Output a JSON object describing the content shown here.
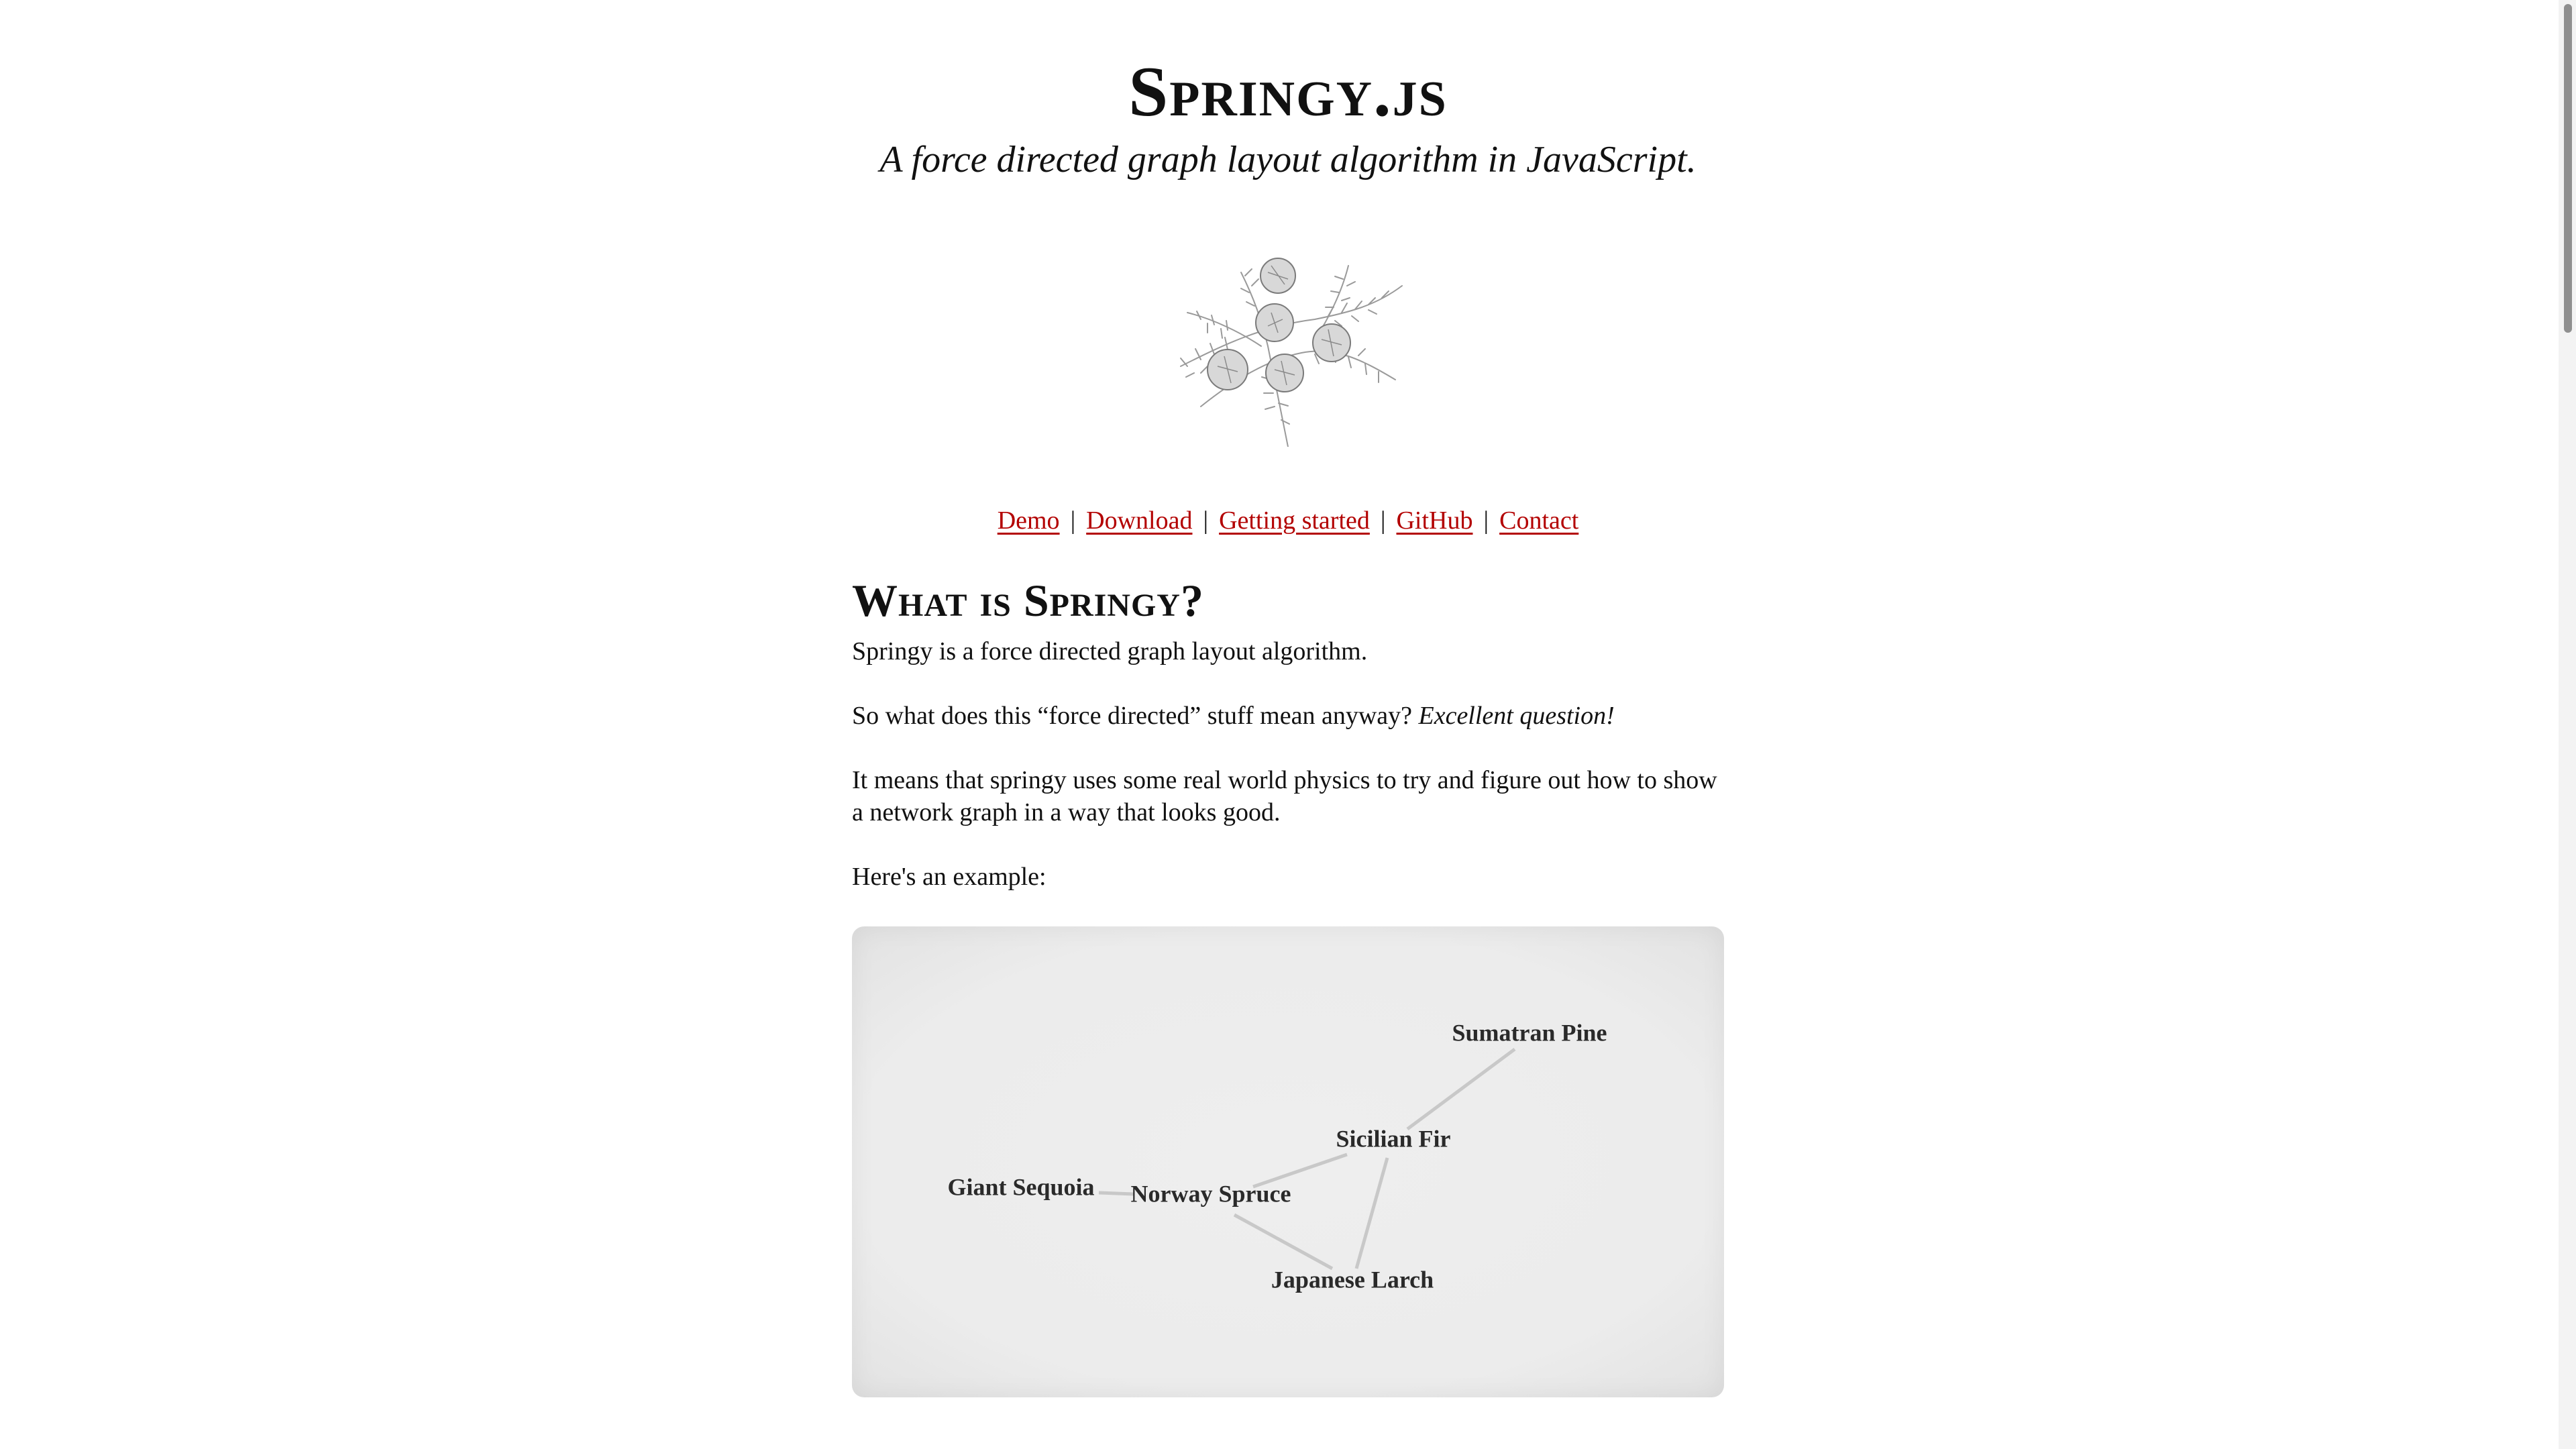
{
  "header": {
    "title": "Springy.js",
    "subtitle": "A force directed graph layout algorithm in JavaScript."
  },
  "logo": {
    "icon": "cypress-branch-icon"
  },
  "nav": {
    "items": [
      {
        "label": "Demo"
      },
      {
        "label": "Download"
      },
      {
        "label": "Getting started"
      },
      {
        "label": "GitHub"
      },
      {
        "label": "Contact"
      }
    ],
    "separator": "|",
    "link_color": "#b30000"
  },
  "content": {
    "heading": "What is Springy?",
    "p1": "Springy is a force directed graph layout algorithm.",
    "p2_text": "So what does this “force directed” stuff mean anyway?",
    "p2_emphasis": "Excellent question!",
    "p3": "It means that springy uses some real world physics to try and figure out how to show a network graph in a way that looks good.",
    "p4": "Here's an example:"
  },
  "graph": {
    "nodes": [
      {
        "id": "sumatran",
        "label": "Sumatran Pine"
      },
      {
        "id": "sicilian",
        "label": "Sicilian Fir"
      },
      {
        "id": "sequoia",
        "label": "Giant Sequoia"
      },
      {
        "id": "norway",
        "label": "Norway Spruce"
      },
      {
        "id": "larch",
        "label": "Japanese Larch"
      }
    ],
    "edges": [
      [
        "sumatran",
        "sicilian"
      ],
      [
        "sicilian",
        "norway"
      ],
      [
        "sicilian",
        "larch"
      ],
      [
        "sequoia",
        "norway"
      ],
      [
        "norway",
        "larch"
      ]
    ]
  }
}
